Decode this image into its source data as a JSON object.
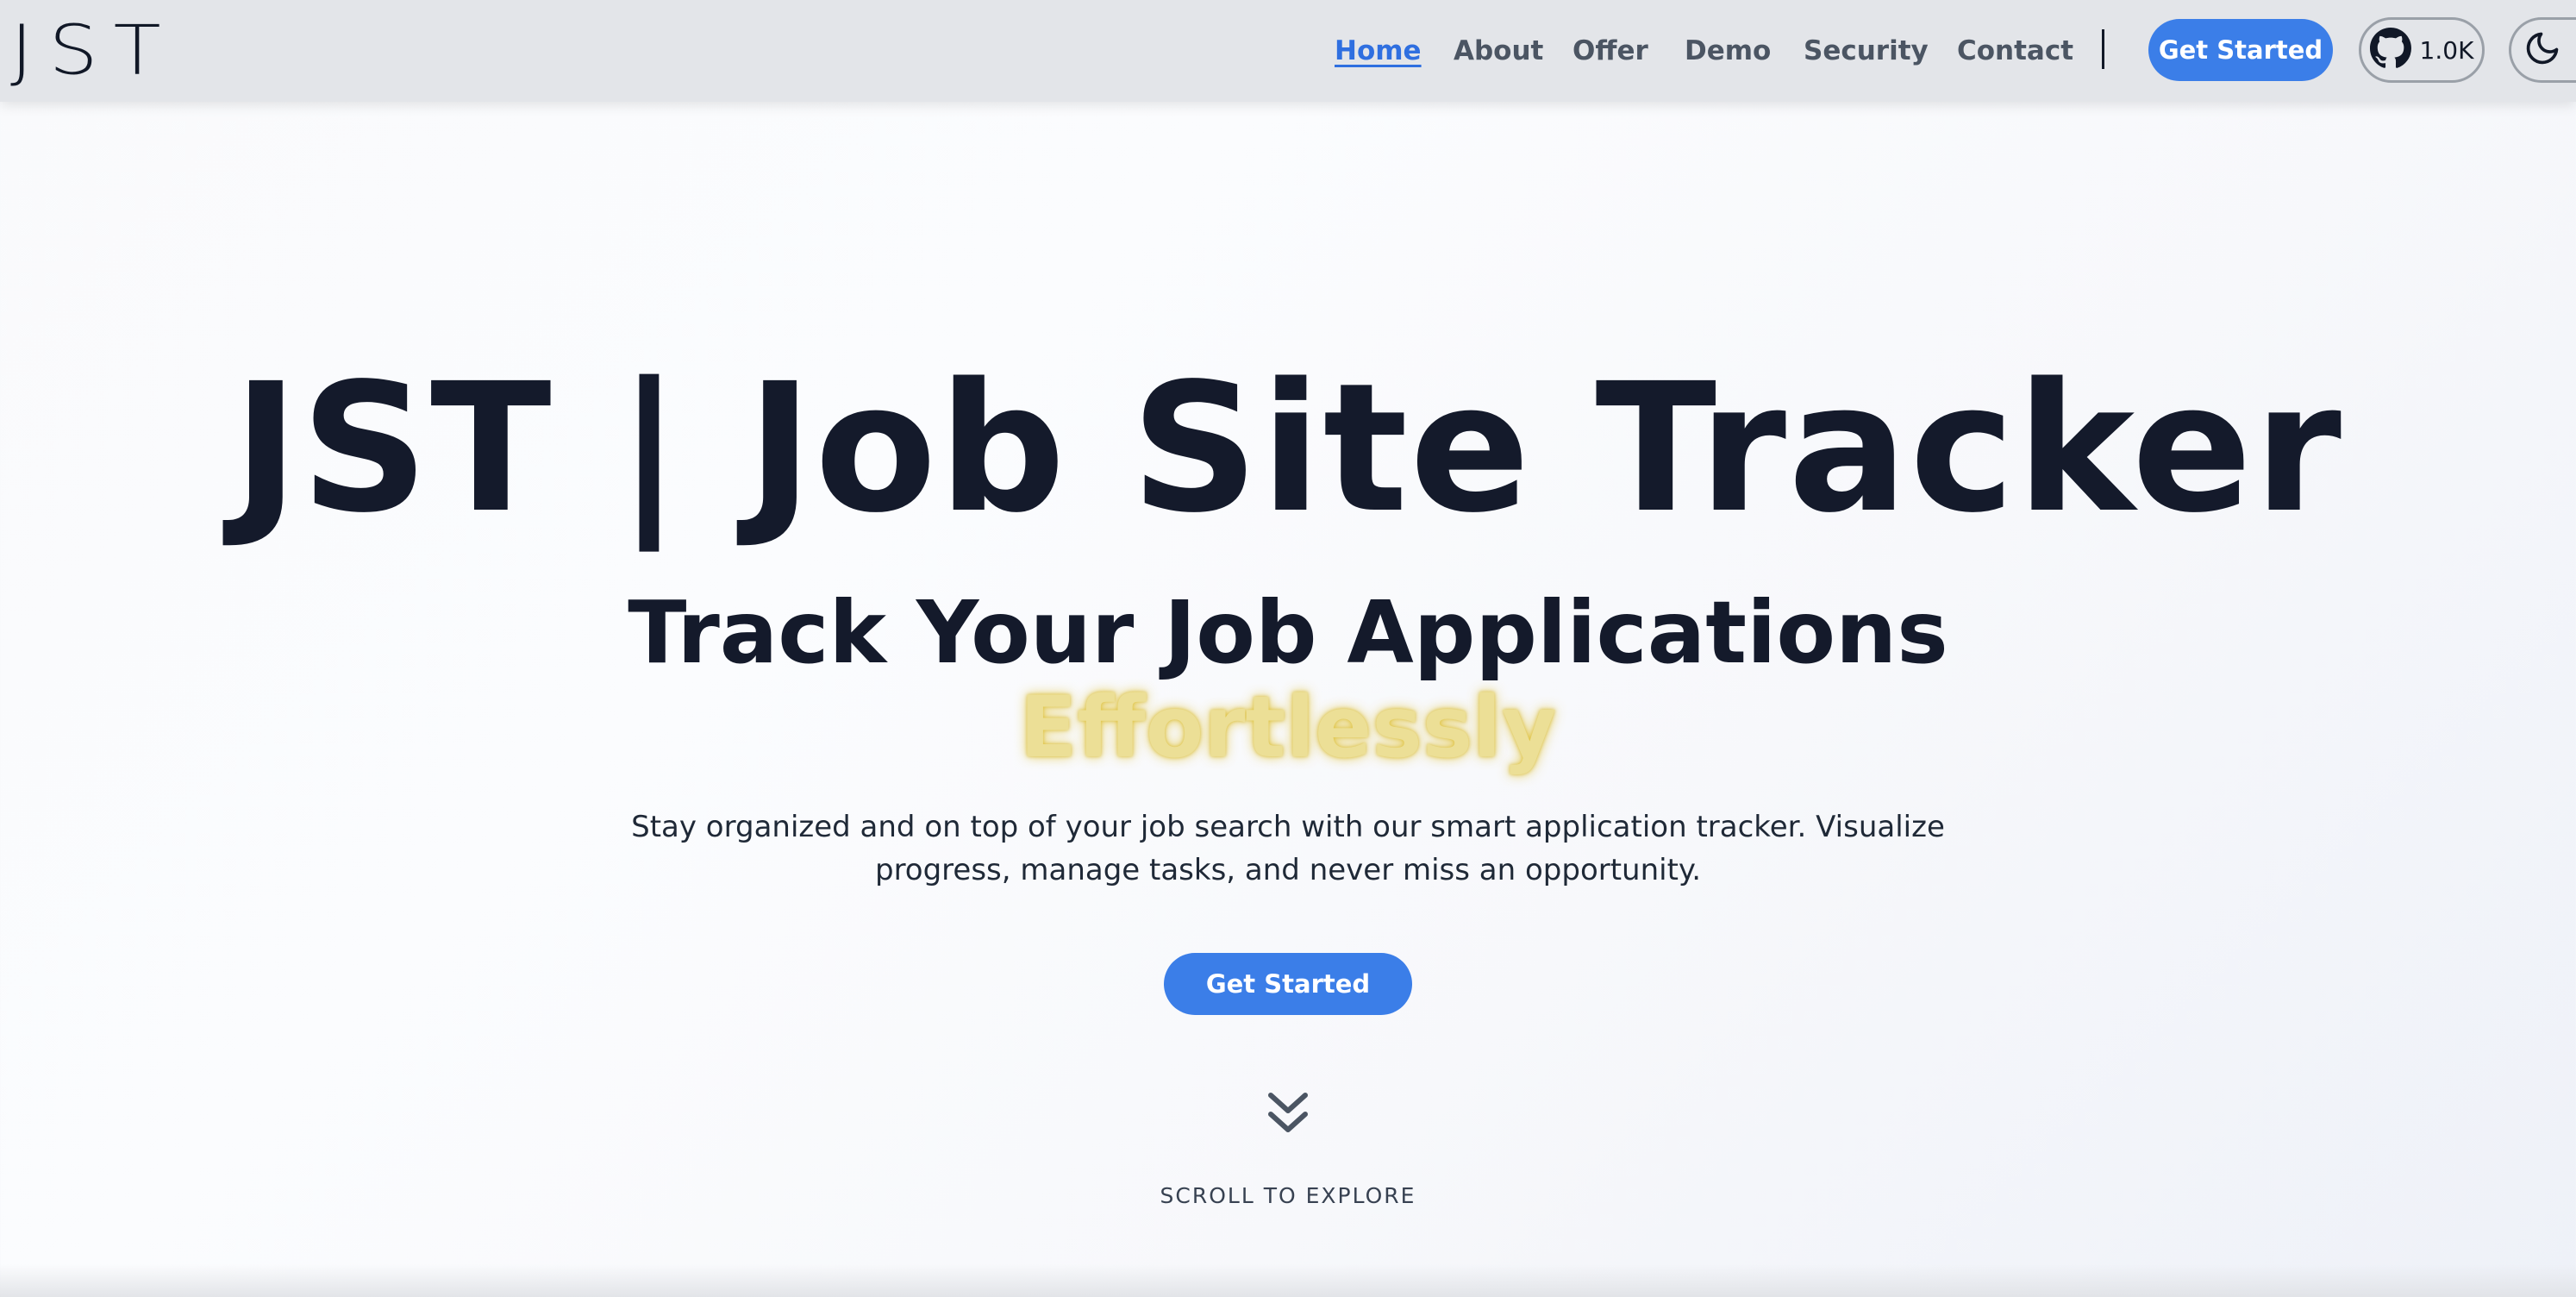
{
  "header": {
    "logo": "JST",
    "nav": [
      {
        "label": "Home",
        "active": true
      },
      {
        "label": "About",
        "active": false
      },
      {
        "label": "Offer",
        "active": false
      },
      {
        "label": "Demo",
        "active": false
      },
      {
        "label": "Security",
        "active": false
      },
      {
        "label": "Contact",
        "active": false
      }
    ],
    "cta_label": "Get Started",
    "github": {
      "icon": "github-icon",
      "stars": "1.0K"
    },
    "theme_toggle_icon": "moon-icon"
  },
  "hero": {
    "title": "JST | Job Site Tracker",
    "subtitle": "Track Your Job Applications",
    "accent": "Effortlessly",
    "description": "Stay organized and on top of your job search with our smart application tracker. Visualize progress, manage tasks, and never miss an opportunity.",
    "cta_label": "Get Started",
    "scroll_icon": "double-chevron-down-icon",
    "scroll_label": "SCROLL TO EXPLORE"
  },
  "colors": {
    "accent_blue": "#3b7ee8",
    "active_link": "#2f6fe0",
    "highlight_yellow": "#ecdf96",
    "text_dark": "#141a2b",
    "header_bg": "#e3e5e9"
  }
}
